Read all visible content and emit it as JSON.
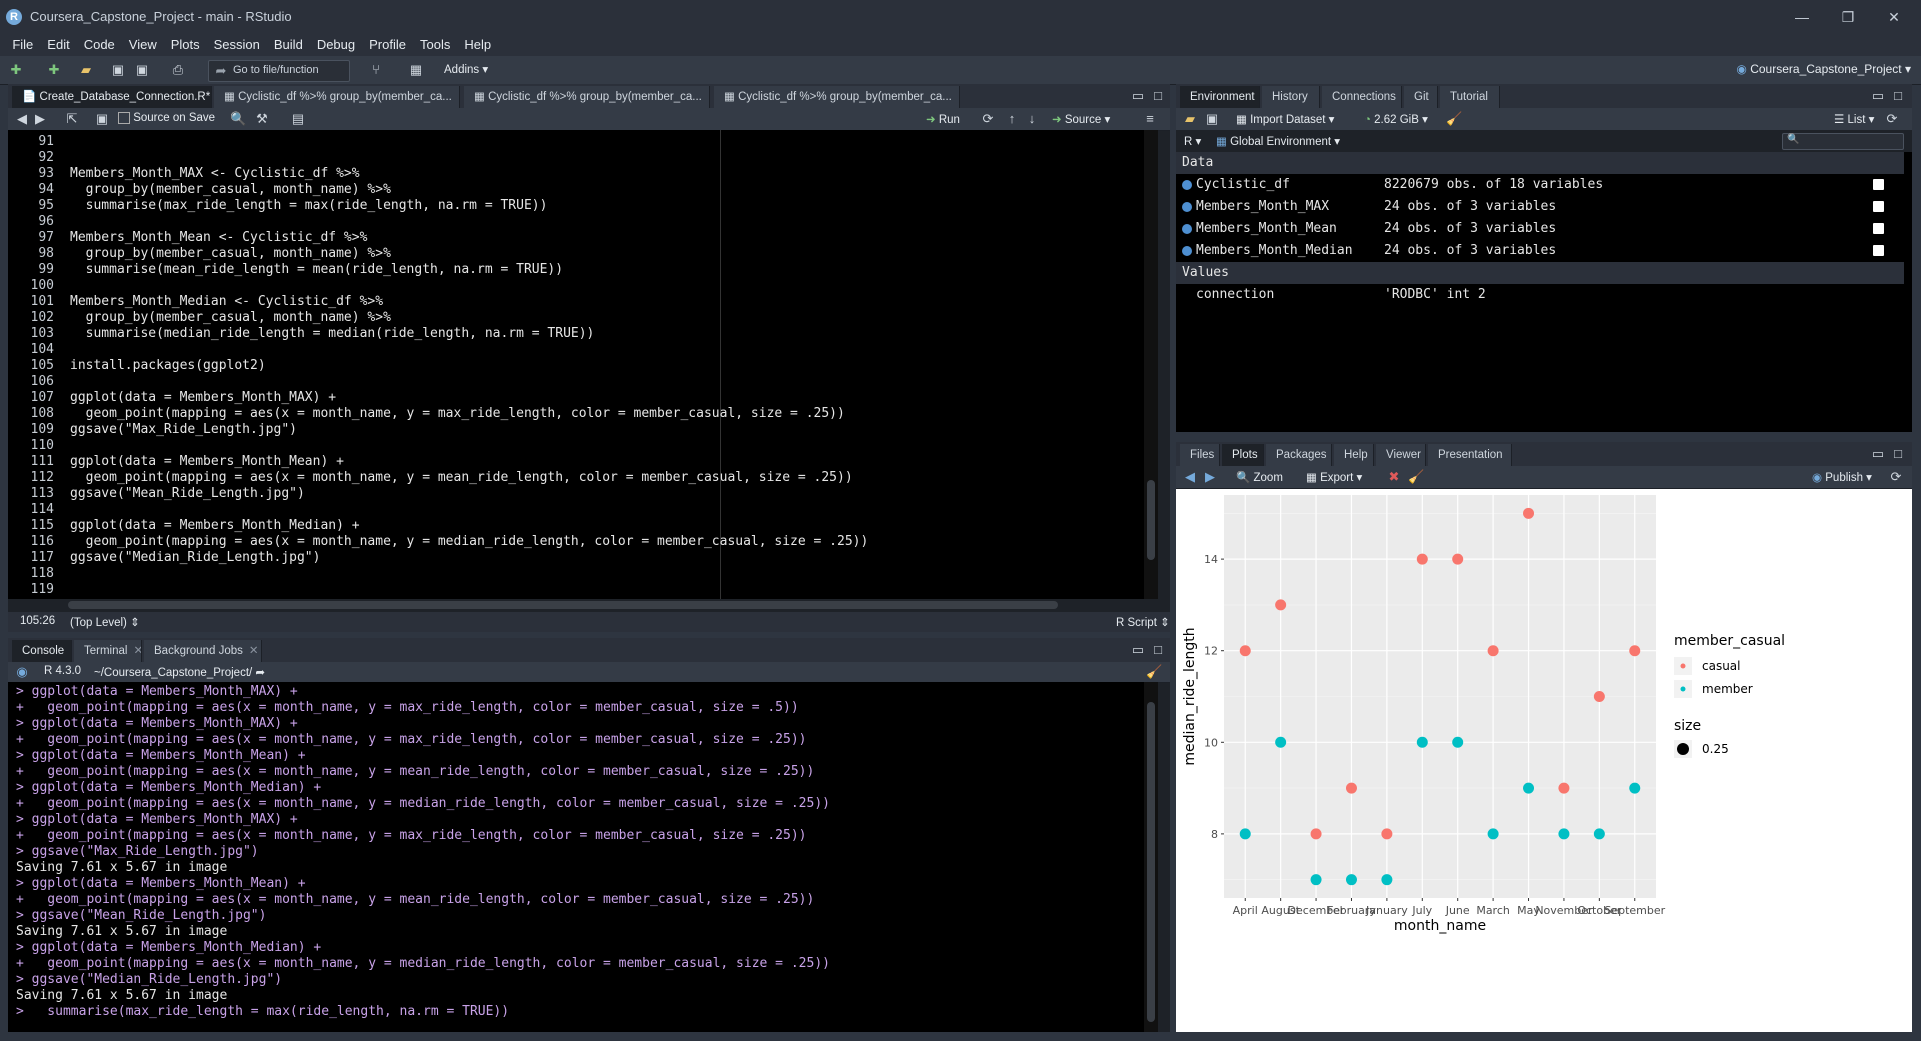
{
  "window": {
    "title": "Coursera_Capstone_Project - main - RStudio",
    "logo": "R"
  },
  "menu": [
    "File",
    "Edit",
    "Code",
    "View",
    "Plots",
    "Session",
    "Build",
    "Debug",
    "Profile",
    "Tools",
    "Help"
  ],
  "toolbar": {
    "goto_placeholder": "Go to file/function",
    "addins": "Addins",
    "project": "Coursera_Capstone_Project"
  },
  "editor": {
    "tabs": [
      "Create_Database_Connection.R*",
      "Cyclistic_df %>% group_by(member_ca...",
      "Cyclistic_df %>% group_by(member_ca...",
      "Cyclistic_df %>% group_by(member_ca..."
    ],
    "source_on_save": "Source on Save",
    "run": "Run",
    "source": "Source",
    "lines": [
      {
        "n": "91",
        "t": ""
      },
      {
        "n": "92",
        "t": ""
      },
      {
        "n": "93",
        "t": "Members_Month_MAX <- Cyclistic_df %>%"
      },
      {
        "n": "94",
        "t": "  group_by(member_casual, month_name) %>%"
      },
      {
        "n": "95",
        "t": "  summarise(max_ride_length = max(ride_length, na.rm = TRUE))"
      },
      {
        "n": "96",
        "t": ""
      },
      {
        "n": "97",
        "t": "Members_Month_Mean <- Cyclistic_df %>%"
      },
      {
        "n": "98",
        "t": "  group_by(member_casual, month_name) %>%"
      },
      {
        "n": "99",
        "t": "  summarise(mean_ride_length = mean(ride_length, na.rm = TRUE))"
      },
      {
        "n": "100",
        "t": ""
      },
      {
        "n": "101",
        "t": "Members_Month_Median <- Cyclistic_df %>%"
      },
      {
        "n": "102",
        "t": "  group_by(member_casual, month_name) %>%"
      },
      {
        "n": "103",
        "t": "  summarise(median_ride_length = median(ride_length, na.rm = TRUE))"
      },
      {
        "n": "104",
        "t": ""
      },
      {
        "n": "105",
        "t": "install.packages(ggplot2)"
      },
      {
        "n": "106",
        "t": ""
      },
      {
        "n": "107",
        "t": "ggplot(data = Members_Month_MAX) +"
      },
      {
        "n": "108",
        "t": "  geom_point(mapping = aes(x = month_name, y = max_ride_length, color = member_casual, size = .25))"
      },
      {
        "n": "109",
        "t": "ggsave(\"Max_Ride_Length.jpg\")"
      },
      {
        "n": "110",
        "t": ""
      },
      {
        "n": "111",
        "t": "ggplot(data = Members_Month_Mean) +"
      },
      {
        "n": "112",
        "t": "  geom_point(mapping = aes(x = month_name, y = mean_ride_length, color = member_casual, size = .25))"
      },
      {
        "n": "113",
        "t": "ggsave(\"Mean_Ride_Length.jpg\")"
      },
      {
        "n": "114",
        "t": ""
      },
      {
        "n": "115",
        "t": "ggplot(data = Members_Month_Median) +"
      },
      {
        "n": "116",
        "t": "  geom_point(mapping = aes(x = month_name, y = median_ride_length, color = member_casual, size = .25))"
      },
      {
        "n": "117",
        "t": "ggsave(\"Median_Ride_Length.jpg\")"
      },
      {
        "n": "118",
        "t": ""
      },
      {
        "n": "119",
        "t": ""
      }
    ],
    "status_pos": "105:26",
    "status_level": "(Top Level)",
    "status_type": "R Script"
  },
  "console": {
    "tabs": [
      "Console",
      "Terminal",
      "Background Jobs"
    ],
    "r_version": "R 4.3.0",
    "path": "~/Coursera_Capstone_Project/",
    "lines": [
      {
        "c": "cmd",
        "t": "> ggplot(data = Members_Month_MAX) +"
      },
      {
        "c": "cmd",
        "t": "+   geom_point(mapping = aes(x = month_name, y = max_ride_length, color = member_casual, size = .5))"
      },
      {
        "c": "cmd",
        "t": "> ggplot(data = Members_Month_MAX) +"
      },
      {
        "c": "cmd",
        "t": "+   geom_point(mapping = aes(x = month_name, y = max_ride_length, color = member_casual, size = .25))"
      },
      {
        "c": "cmd",
        "t": "> ggplot(data = Members_Month_Mean) +"
      },
      {
        "c": "cmd",
        "t": "+   geom_point(mapping = aes(x = month_name, y = mean_ride_length, color = member_casual, size = .25))"
      },
      {
        "c": "cmd",
        "t": "> ggplot(data = Members_Month_Median) +"
      },
      {
        "c": "cmd",
        "t": "+   geom_point(mapping = aes(x = month_name, y = median_ride_length, color = member_casual, size = .25))"
      },
      {
        "c": "cmd",
        "t": "> ggplot(data = Members_Month_MAX) +"
      },
      {
        "c": "cmd",
        "t": "+   geom_point(mapping = aes(x = month_name, y = max_ride_length, color = member_casual, size = .25))"
      },
      {
        "c": "cmd",
        "t": "> ggsave(\"Max_Ride_Length.jpg\")"
      },
      {
        "c": "out",
        "t": "Saving 7.61 x 5.67 in image"
      },
      {
        "c": "cmd",
        "t": "> ggplot(data = Members_Month_Mean) +"
      },
      {
        "c": "cmd",
        "t": "+   geom_point(mapping = aes(x = month_name, y = mean_ride_length, color = member_casual, size = .25))"
      },
      {
        "c": "cmd",
        "t": "> ggsave(\"Mean_Ride_Length.jpg\")"
      },
      {
        "c": "out",
        "t": "Saving 7.61 x 5.67 in image"
      },
      {
        "c": "cmd",
        "t": "> ggplot(data = Members_Month_Median) +"
      },
      {
        "c": "cmd",
        "t": "+   geom_point(mapping = aes(x = month_name, y = median_ride_length, color = member_casual, size = .25))"
      },
      {
        "c": "cmd",
        "t": "> ggsave(\"Median_Ride_Length.jpg\")"
      },
      {
        "c": "out",
        "t": "Saving 7.61 x 5.67 in image"
      },
      {
        "c": "cmd",
        "t": ">   summarise(max_ride_length = max(ride_length, na.rm = TRUE))"
      }
    ]
  },
  "env": {
    "tabs": [
      "Environment",
      "History",
      "Connections",
      "Git",
      "Tutorial"
    ],
    "import_dataset": "Import Dataset",
    "memory": "2.62 GiB",
    "list_view": "List",
    "lang": "R",
    "scope": "Global Environment",
    "data_header": "Data",
    "data": [
      {
        "name": "Cyclistic_df",
        "value": "8220679 obs. of 18 variables"
      },
      {
        "name": "Members_Month_MAX",
        "value": "24 obs. of 3 variables"
      },
      {
        "name": "Members_Month_Mean",
        "value": "24 obs. of 3 variables"
      },
      {
        "name": "Members_Month_Median",
        "value": "24 obs. of 3 variables"
      }
    ],
    "values_header": "Values",
    "values": [
      {
        "name": "connection",
        "value": "'RODBC' int 2"
      }
    ]
  },
  "files": {
    "tabs": [
      "Files",
      "Plots",
      "Packages",
      "Help",
      "Viewer",
      "Presentation"
    ],
    "zoom": "Zoom",
    "export": "Export",
    "publish": "Publish"
  },
  "chart_data": {
    "type": "scatter",
    "xlabel": "month_name",
    "ylabel": "median_ride_length",
    "categories": [
      "April",
      "August",
      "December",
      "February",
      "January",
      "July",
      "June",
      "March",
      "May",
      "November",
      "October",
      "September"
    ],
    "series": [
      {
        "name": "casual",
        "color": "#f8766d",
        "values": [
          12,
          13,
          8,
          9,
          8,
          14,
          14,
          12,
          15,
          9,
          11,
          12
        ]
      },
      {
        "name": "member",
        "color": "#00bfc4",
        "values": [
          8,
          10,
          7,
          7,
          7,
          10,
          10,
          8,
          9,
          8,
          8,
          9
        ]
      }
    ],
    "yticks": [
      8,
      10,
      12,
      14
    ],
    "ylim": [
      6.6,
      15.4
    ],
    "grid": true,
    "legend": {
      "title": "member_casual",
      "placement": "right",
      "size_title": "size",
      "size_value": "0.25"
    }
  }
}
